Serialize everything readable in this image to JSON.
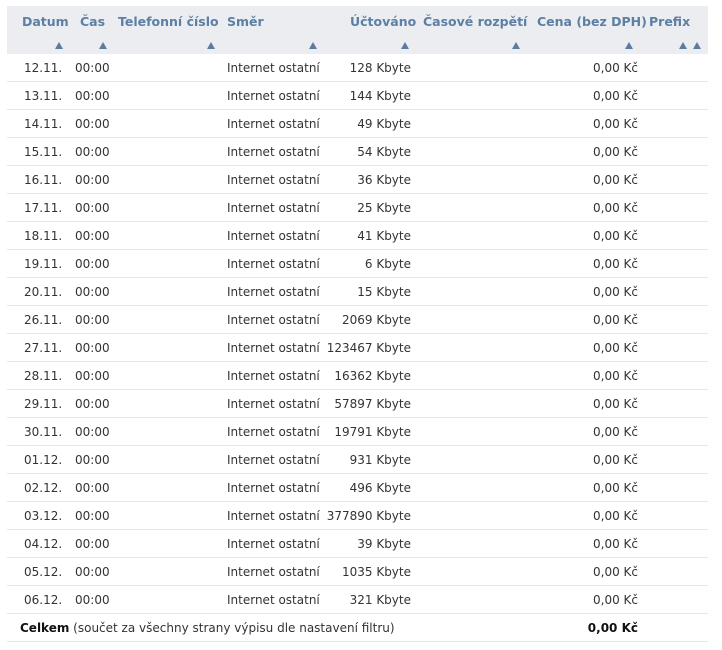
{
  "table": {
    "columns": [
      {
        "label": "Datum",
        "sort": "Datum"
      },
      {
        "label": "Čas",
        "sort": "Čas"
      },
      {
        "label": "Telefonní číslo",
        "sort": "Telefonní číslo"
      },
      {
        "label": "Směr",
        "sort": "Směr"
      },
      {
        "label": "Účtováno",
        "sort": "Účtováno"
      },
      {
        "label": "Časové rozpětí",
        "sort": "Časové rozpětí"
      },
      {
        "label": "Cena (bez DPH)",
        "sort": "Cena (bez DPH)"
      },
      {
        "label": "Prefix",
        "sort": "Prefix"
      }
    ],
    "rows": [
      {
        "date": "12.11.",
        "time": "00:00",
        "phone": "",
        "direction": "Internet ostatní",
        "charged": "128 Kbyte",
        "span": "",
        "price": "0,00 Kč",
        "prefix": ""
      },
      {
        "date": "13.11.",
        "time": "00:00",
        "phone": "",
        "direction": "Internet ostatní",
        "charged": "144 Kbyte",
        "span": "",
        "price": "0,00 Kč",
        "prefix": ""
      },
      {
        "date": "14.11.",
        "time": "00:00",
        "phone": "",
        "direction": "Internet ostatní",
        "charged": "49 Kbyte",
        "span": "",
        "price": "0,00 Kč",
        "prefix": ""
      },
      {
        "date": "15.11.",
        "time": "00:00",
        "phone": "",
        "direction": "Internet ostatní",
        "charged": "54 Kbyte",
        "span": "",
        "price": "0,00 Kč",
        "prefix": ""
      },
      {
        "date": "16.11.",
        "time": "00:00",
        "phone": "",
        "direction": "Internet ostatní",
        "charged": "36 Kbyte",
        "span": "",
        "price": "0,00 Kč",
        "prefix": ""
      },
      {
        "date": "17.11.",
        "time": "00:00",
        "phone": "",
        "direction": "Internet ostatní",
        "charged": "25 Kbyte",
        "span": "",
        "price": "0,00 Kč",
        "prefix": ""
      },
      {
        "date": "18.11.",
        "time": "00:00",
        "phone": "",
        "direction": "Internet ostatní",
        "charged": "41 Kbyte",
        "span": "",
        "price": "0,00 Kč",
        "prefix": ""
      },
      {
        "date": "19.11.",
        "time": "00:00",
        "phone": "",
        "direction": "Internet ostatní",
        "charged": "6 Kbyte",
        "span": "",
        "price": "0,00 Kč",
        "prefix": ""
      },
      {
        "date": "20.11.",
        "time": "00:00",
        "phone": "",
        "direction": "Internet ostatní",
        "charged": "15 Kbyte",
        "span": "",
        "price": "0,00 Kč",
        "prefix": ""
      },
      {
        "date": "26.11.",
        "time": "00:00",
        "phone": "",
        "direction": "Internet ostatní",
        "charged": "2069 Kbyte",
        "span": "",
        "price": "0,00 Kč",
        "prefix": ""
      },
      {
        "date": "27.11.",
        "time": "00:00",
        "phone": "",
        "direction": "Internet ostatní",
        "charged": "123467 Kbyte",
        "span": "",
        "price": "0,00 Kč",
        "prefix": ""
      },
      {
        "date": "28.11.",
        "time": "00:00",
        "phone": "",
        "direction": "Internet ostatní",
        "charged": "16362 Kbyte",
        "span": "",
        "price": "0,00 Kč",
        "prefix": ""
      },
      {
        "date": "29.11.",
        "time": "00:00",
        "phone": "",
        "direction": "Internet ostatní",
        "charged": "57897 Kbyte",
        "span": "",
        "price": "0,00 Kč",
        "prefix": ""
      },
      {
        "date": "30.11.",
        "time": "00:00",
        "phone": "",
        "direction": "Internet ostatní",
        "charged": "19791 Kbyte",
        "span": "",
        "price": "0,00 Kč",
        "prefix": ""
      },
      {
        "date": "01.12.",
        "time": "00:00",
        "phone": "",
        "direction": "Internet ostatní",
        "charged": "931 Kbyte",
        "span": "",
        "price": "0,00 Kč",
        "prefix": ""
      },
      {
        "date": "02.12.",
        "time": "00:00",
        "phone": "",
        "direction": "Internet ostatní",
        "charged": "496 Kbyte",
        "span": "",
        "price": "0,00 Kč",
        "prefix": ""
      },
      {
        "date": "03.12.",
        "time": "00:00",
        "phone": "",
        "direction": "Internet ostatní",
        "charged": "377890 Kbyte",
        "span": "",
        "price": "0,00 Kč",
        "prefix": ""
      },
      {
        "date": "04.12.",
        "time": "00:00",
        "phone": "",
        "direction": "Internet ostatní",
        "charged": "39 Kbyte",
        "span": "",
        "price": "0,00 Kč",
        "prefix": ""
      },
      {
        "date": "05.12.",
        "time": "00:00",
        "phone": "",
        "direction": "Internet ostatní",
        "charged": "1035 Kbyte",
        "span": "",
        "price": "0,00 Kč",
        "prefix": ""
      },
      {
        "date": "06.12.",
        "time": "00:00",
        "phone": "",
        "direction": "Internet ostatní",
        "charged": "321 Kbyte",
        "span": "",
        "price": "0,00 Kč",
        "prefix": ""
      }
    ],
    "footer": {
      "label_bold": "Celkem",
      "label_rest": " (součet za všechny strany výpisu dle nastavení filtru)",
      "total": "0,00 Kč"
    }
  },
  "colors": {
    "header_bg": "#ebedf0",
    "header_text": "#5c7fa5",
    "sort_arrow": "#5a7ca3",
    "row_border": "#e3e6ea"
  },
  "icons": {
    "sort": "sort-up-arrow-icon"
  }
}
